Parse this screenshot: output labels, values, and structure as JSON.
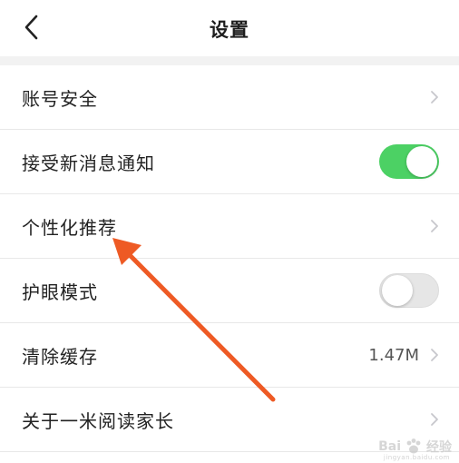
{
  "header": {
    "title": "设置",
    "back_icon": "chevron-left-icon"
  },
  "settings": {
    "items": [
      {
        "label": "账号安全",
        "type": "link"
      },
      {
        "label": "接受新消息通知",
        "type": "toggle",
        "enabled": true
      },
      {
        "label": "个性化推荐",
        "type": "link"
      },
      {
        "label": "护眼模式",
        "type": "toggle",
        "enabled": false
      },
      {
        "label": "清除缓存",
        "type": "link",
        "value": "1.47M"
      },
      {
        "label": "关于一米阅读家长",
        "type": "link"
      }
    ]
  },
  "annotation": {
    "arrow_color": "#ee5a24",
    "target": "个性化推荐"
  },
  "watermark": {
    "text": "Bai",
    "text2": "经验",
    "sub": "jingyan.baidu.com"
  },
  "colors": {
    "toggle_on": "#4cd164",
    "toggle_off": "#e6e6e6",
    "chevron": "#c7c7cc",
    "background": "#ffffff",
    "separator": "#f2f2f2"
  }
}
